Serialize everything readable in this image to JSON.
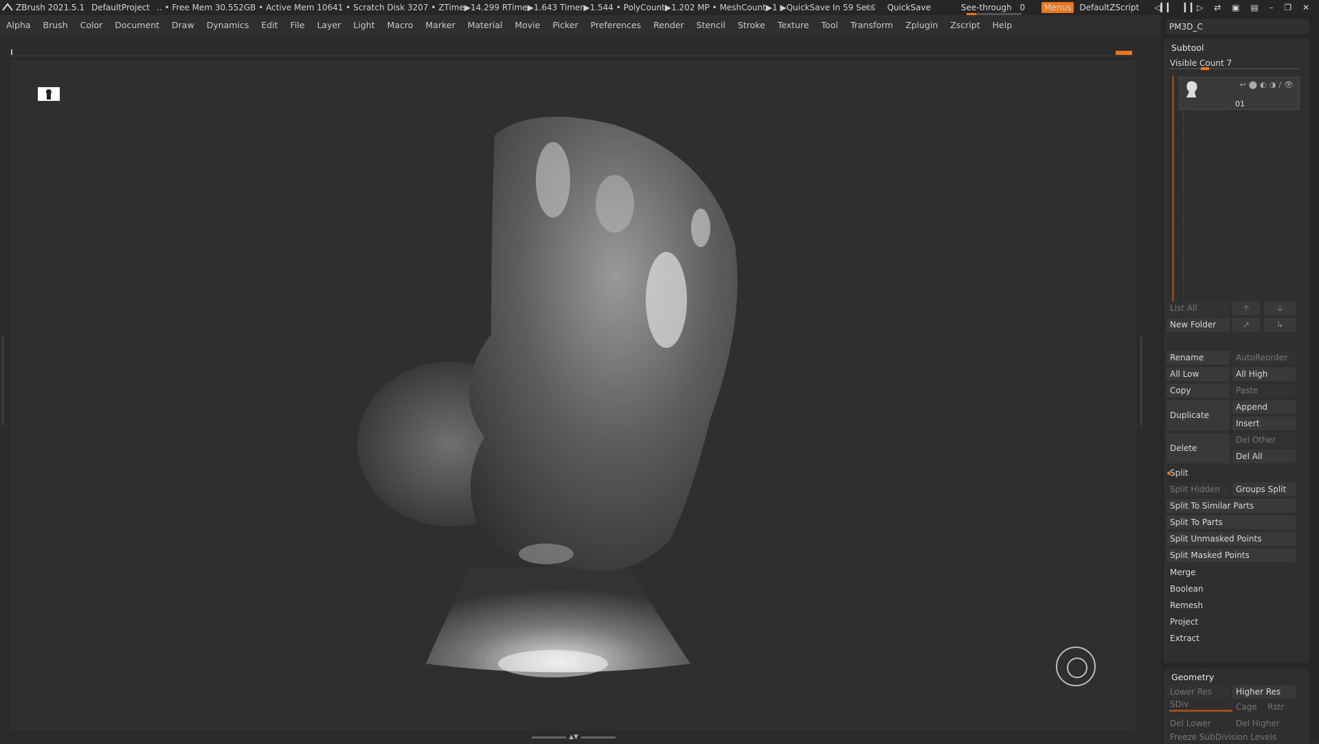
{
  "app": {
    "title": "ZBrush 2021.5.1",
    "project": "DefaultProject",
    "status": "..  • Free Mem 30.552GB • Active Mem 10641 • Scratch Disk 3207 •  ZTime▶14.299 RTime▶1.643 Timer▶1.544 • PolyCount▶1.202 MP  • MeshCount▶1  ▶QuickSave In 59 Secs",
    "ac": "AC",
    "quicksave": "QuickSave",
    "see_through_label": "See-through",
    "see_through_value": "0",
    "menus": "Menus",
    "zscript": "DefaultZScript"
  },
  "menubar": [
    "Alpha",
    "Brush",
    "Color",
    "Document",
    "Draw",
    "Dynamics",
    "Edit",
    "File",
    "Layer",
    "Light",
    "Macro",
    "Marker",
    "Material",
    "Movie",
    "Picker",
    "Preferences",
    "Render",
    "Stencil",
    "Stroke",
    "Texture",
    "Tool",
    "Transform",
    "Zplugin",
    "Zscript",
    "Help"
  ],
  "panel": {
    "tool_name": "PM3D_C",
    "subtool": {
      "title": "Subtool",
      "visible_count": "Visible Count 7",
      "entry_name": "01",
      "list_all": "List All",
      "new_folder": "New Folder",
      "rename": "Rename",
      "autoreorder": "AutoReorder",
      "all_low": "All Low",
      "all_high": "All High",
      "copy": "Copy",
      "paste": "Paste",
      "duplicate": "Duplicate",
      "append": "Append",
      "insert": "Insert",
      "delete": "Delete",
      "del_other": "Del Other",
      "del_all": "Del All",
      "split": "Split",
      "split_hidden": "Split Hidden",
      "groups_split": "Groups Split",
      "split_similar": "Split To Similar Parts",
      "split_parts": "Split To Parts",
      "split_unmasked": "Split Unmasked Points",
      "split_masked": "Split Masked Points",
      "merge": "Merge",
      "boolean": "Boolean",
      "remesh": "Remesh",
      "project": "Project",
      "extract": "Extract"
    },
    "geometry": {
      "title": "Geometry",
      "lower_res": "Lower Res",
      "higher_res": "Higher Res",
      "sdiv": "SDiv",
      "cage": "Cage",
      "rstr": "Rstr",
      "del_lower": "Del Lower",
      "del_higher": "Del Higher",
      "freeze": "Freeze SubDivision Levels"
    }
  }
}
